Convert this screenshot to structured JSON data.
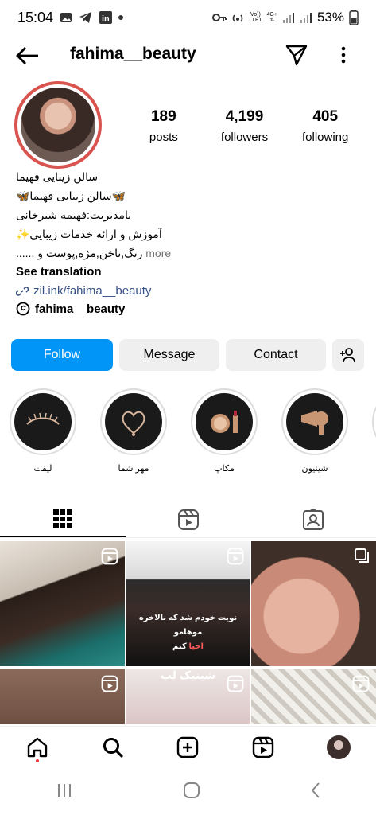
{
  "status": {
    "time": "15:04",
    "battery": "53%",
    "network_top": "Vo))",
    "network_bottom": "LTE1",
    "data_top": "4G+"
  },
  "header": {
    "username": "fahima__beauty"
  },
  "profile": {
    "stats": [
      {
        "value": "189",
        "label": "posts"
      },
      {
        "value": "4,199",
        "label": "followers"
      },
      {
        "value": "405",
        "label": "following"
      }
    ],
    "bio_lines": [
      "سالن زیبایی فهیما",
      "🦋سالن زیبایی فهیما🦋",
      "بامدیریت:فهیمه شیرخانی",
      "آموزش و ارائه خدمات زیبایی✨",
      "رنگ,ناخن,مژه,پوست و ......"
    ],
    "more": "more",
    "see_translation": "See translation",
    "link": "zil.ink/fahima__beauty",
    "threads_handle": "fahima__beauty"
  },
  "buttons": {
    "follow": "Follow",
    "message": "Message",
    "contact": "Contact"
  },
  "highlights": [
    {
      "label": "لیفت",
      "icon": "eyelash-icon"
    },
    {
      "label": "مهر شما",
      "icon": "heart-pendant-icon"
    },
    {
      "label": "مکاپ",
      "icon": "makeup-icon"
    },
    {
      "label": "شینیون",
      "icon": "hair-dryer-icon"
    }
  ],
  "grid": {
    "overlay_text_1": "نوبت خودم شد که بالاخره موهامو",
    "overlay_text_2": "احیا",
    "overlay_text_3": "کنم",
    "overlay_brand": "شینیک لب"
  },
  "colors": {
    "follow_blue": "#0095f6",
    "ring_red": "#d9534f",
    "link_blue": "#385185"
  }
}
